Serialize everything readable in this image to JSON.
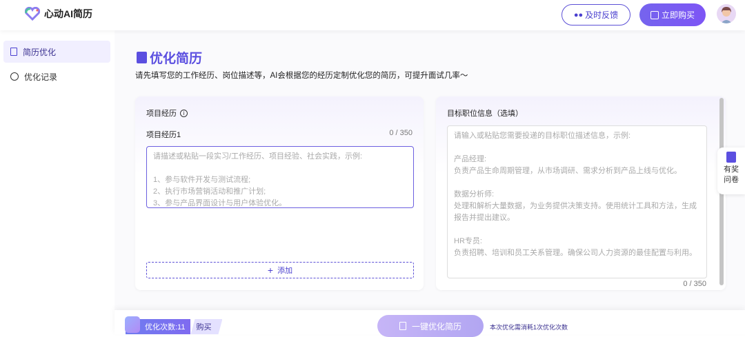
{
  "header": {
    "app_name": "心动AI简历",
    "feedback_label": "及时反馈",
    "buy_label": "立即购买"
  },
  "sidebar": {
    "items": [
      {
        "label": "简历优化"
      },
      {
        "label": "优化记录"
      }
    ]
  },
  "page": {
    "title": "优化简历",
    "subtitle": "请先填写您的工作经历、岗位描述等，AI会根据您的经历定制优化您的简历，可提升面试几率～"
  },
  "project": {
    "section_title": "项目经历",
    "item_label": "项目经历1",
    "count": "0 / 350",
    "placeholder": "请描述或粘贴一段实习/工作经历、项目经验、社会实践，示例:\n\n1、参与软件开发与测试流程;\n2、执行市场营销活动和推广计划;\n3、参与产品界面设计与用户体验优化。",
    "add_label": "添加"
  },
  "target": {
    "section_title": "目标职位信息（选填）",
    "count": "0 / 350",
    "placeholder": "请输入或粘贴您需要投递的目标职位描述信息，示例:\n\n产品经理:\n负责产品生命周期管理，从市场调研、需求分析到产品上线与优化。\n\n数据分析师:\n处理和解析大量数据，为业务提供决策支持。使用统计工具和方法，生成报告并提出建议。\n\nHR专员:\n负责招聘、培训和员工关系管理。确保公司人力资源的最佳配置与利用。"
  },
  "survey": {
    "line1": "有奖",
    "line2": "问卷"
  },
  "footer": {
    "times_label": "优化次数:11",
    "buy_label": "购买",
    "optimize_label": "一键优化简历",
    "tip": "本次优化需消耗1次优化次数"
  }
}
